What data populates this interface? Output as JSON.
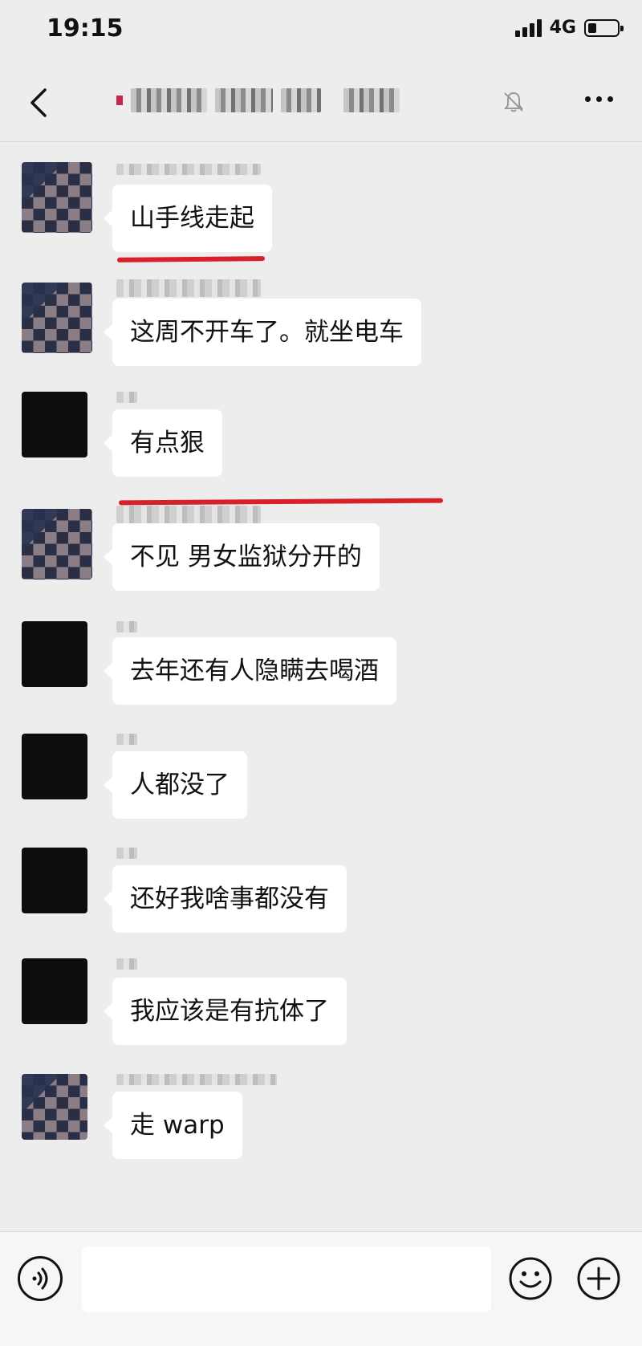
{
  "status_bar": {
    "time": "19:15",
    "network": "4G",
    "battery_level": 0.3
  },
  "header": {
    "back_icon": "chevron-left-icon",
    "mute_icon": "bell-muted-icon",
    "more_icon": "more-dots-icon"
  },
  "messages": [
    {
      "avatar": "pixel",
      "text": "山手线走起",
      "highlighted": true
    },
    {
      "avatar": "pixel",
      "text": "这周不开车了。就坐电车",
      "highlighted": true
    },
    {
      "avatar": "dark",
      "text": "有点狠",
      "highlighted": false
    },
    {
      "avatar": "pixel",
      "text": "不见 男女监狱分开的",
      "highlighted": false
    },
    {
      "avatar": "dark",
      "text": "去年还有人隐瞒去喝酒",
      "highlighted": false
    },
    {
      "avatar": "dark",
      "text": "人都没了",
      "highlighted": false
    },
    {
      "avatar": "dark",
      "text": "还好我啥事都没有",
      "highlighted": false
    },
    {
      "avatar": "dark",
      "text": "我应该是有抗体了",
      "highlighted": false
    },
    {
      "avatar": "pixel",
      "text": "走 warp",
      "highlighted": false
    }
  ],
  "input_bar": {
    "voice_icon": "voice-icon",
    "emoji_icon": "emoji-icon",
    "plus_icon": "plus-icon",
    "value": ""
  },
  "colors": {
    "background": "#ededed",
    "bubble": "#ffffff",
    "highlight_underline": "#d8202a"
  }
}
